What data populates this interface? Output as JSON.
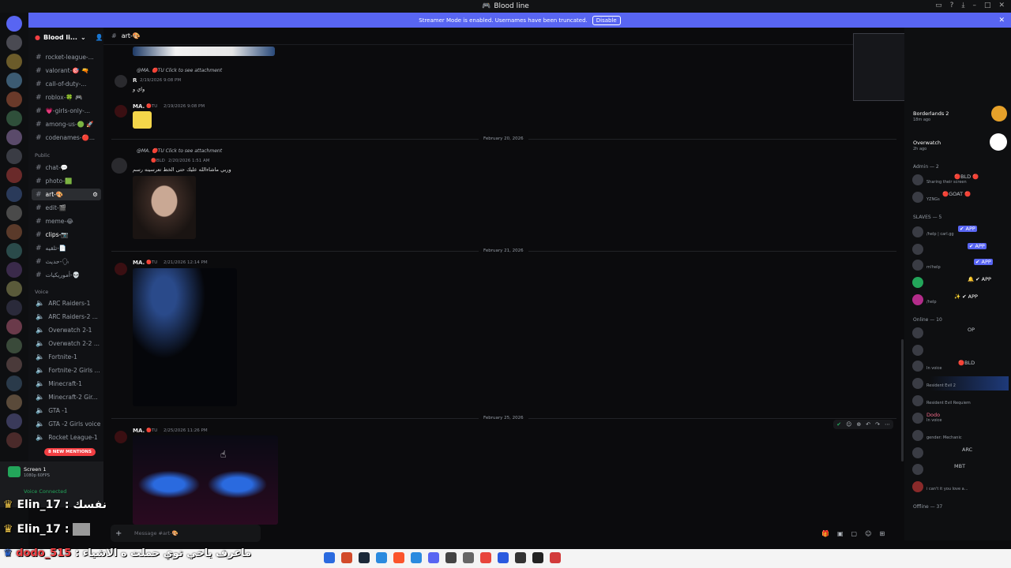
{
  "window": {
    "title": "Blood line",
    "icon": "discord-icon"
  },
  "banner": {
    "text": "Streamer Mode is enabled. Usernames have been truncated.",
    "button": "Disable"
  },
  "guild": {
    "name": "Blood li..."
  },
  "channels": {
    "items": [
      {
        "name": "rocket-league-..."
      },
      {
        "name": "valorant-🎯 🔫"
      },
      {
        "name": "call-of-duty-..."
      },
      {
        "name": "roblox-🍀 🎮"
      },
      {
        "name": "💗-girls-only-..."
      },
      {
        "name": "among-us-🟢 🚀"
      },
      {
        "name": "codenames-🔴..."
      }
    ],
    "public_label": "Public",
    "public_items": [
      {
        "name": "chat-💬"
      },
      {
        "name": "photo-🟩"
      },
      {
        "name": "art-🎨"
      },
      {
        "name": "edit-🎬"
      },
      {
        "name": "meme-😂"
      },
      {
        "name": "clips-📷"
      },
      {
        "name": "تلقيه-📄"
      },
      {
        "name": "حديث-🗣"
      },
      {
        "name": "أموريكيات-💀"
      }
    ],
    "voice_label": "Voice",
    "voice_items": [
      {
        "name": "ARC Raiders-1"
      },
      {
        "name": "ARC Raiders-2 ..."
      },
      {
        "name": "Overwatch 2-1"
      },
      {
        "name": "Overwatch 2-2 ..."
      },
      {
        "name": "Fortnite-1"
      },
      {
        "name": "Fortnite-2 Girls ..."
      },
      {
        "name": "Minecraft-1"
      },
      {
        "name": "Minecraft-2 Gir..."
      },
      {
        "name": "GTA -1"
      },
      {
        "name": "GTA -2 Girls voice"
      },
      {
        "name": "Rocket League-1"
      }
    ],
    "new_mentions": "8 NEW MENTIONS"
  },
  "user_panel": {
    "screen_label": "Screen 1",
    "screen_sub": "1080p 60FPS",
    "voice_label": "Voice Connected"
  },
  "chat": {
    "channel": "art-🎨",
    "messages": [
      {
        "reply": "@MA. 🔴TU Click to see attachment",
        "author": "R",
        "time": "2/19/2026 9:08 PM",
        "text": "واي و"
      },
      {
        "author": "MA.",
        "tag": "🔴TU",
        "time": "2/19/2026 9:08 PM"
      },
      {
        "reply": "@MA. 🔴TU Click to see attachment",
        "tag": "🔴BLD",
        "time": "2/20/2026 1:51 AM",
        "text": "وربي ماشاءالله عليك حتى الخط تعرسينه رسم"
      },
      {
        "author": "MA.",
        "tag": "🔴TU",
        "time": "2/21/2026 12:14 PM"
      },
      {
        "author": "MA.",
        "tag": "🔴TU",
        "time": "2/25/2026 11:26 PM"
      }
    ],
    "dividers": [
      "February 20, 2026",
      "February 21, 2026",
      "February 25, 2026"
    ],
    "composer_placeholder": "Message #art-🎨"
  },
  "members": {
    "activities": [
      {
        "game": "Borderlands 2",
        "time": "18m ago"
      },
      {
        "game": "Overwatch",
        "time": "2h ago"
      }
    ],
    "admin_header": "Admin — 2",
    "admins": [
      {
        "name": "🔴BLD 🔴",
        "status": "Sharing their screen"
      },
      {
        "name": "🔴GOAT 🔴",
        "status": "YZNGs"
      }
    ],
    "slaves_header": "SLAVES — 5",
    "slaves": [
      {
        "name": "",
        "badge": "✔ APP",
        "status": "/help | carl.gg"
      },
      {
        "name": "",
        "badge": "✔ APP",
        "status": ""
      },
      {
        "name": "",
        "badge": "✔ APP",
        "status": "m!help"
      },
      {
        "name": "",
        "badge": "🔔 ✔ APP",
        "status": ""
      },
      {
        "name": "",
        "badge": "✨ ✔ APP",
        "status": "/help"
      }
    ],
    "online_header": "Online — 10",
    "online": [
      {
        "name": "",
        "badge": "OP",
        "status": ""
      },
      {
        "name": "",
        "badge": "",
        "status": ""
      },
      {
        "name": "",
        "badge": "🔴BLD",
        "status": "In voice"
      },
      {
        "name": "",
        "badge": "",
        "status": "Resident Evil 2"
      },
      {
        "name": "",
        "badge": "",
        "status": "Resident Evil Requiem"
      },
      {
        "name": "Dodo",
        "badge": "",
        "status": "In voice"
      },
      {
        "name": "",
        "badge": "",
        "status": "gender: Mechanic"
      },
      {
        "name": "",
        "badge": "ARC",
        "status": ""
      },
      {
        "name": "",
        "badge": "MBT",
        "status": ""
      },
      {
        "name": "",
        "badge": "",
        "status": "i can't it you love a..."
      }
    ],
    "offline_header": "Offline — 37"
  },
  "stream_chat": [
    {
      "user": "Elin_17",
      "text": "نفسك"
    },
    {
      "user": "Elin_17",
      "text": ""
    },
    {
      "user": "dodo_515",
      "text": "ماعرف ياخي توي حملت ه الاشياء"
    }
  ],
  "colors": {
    "accent": "#5865f2",
    "mention": "#f23f43",
    "online": "#23a55a",
    "app_badge": "#5865f2"
  }
}
